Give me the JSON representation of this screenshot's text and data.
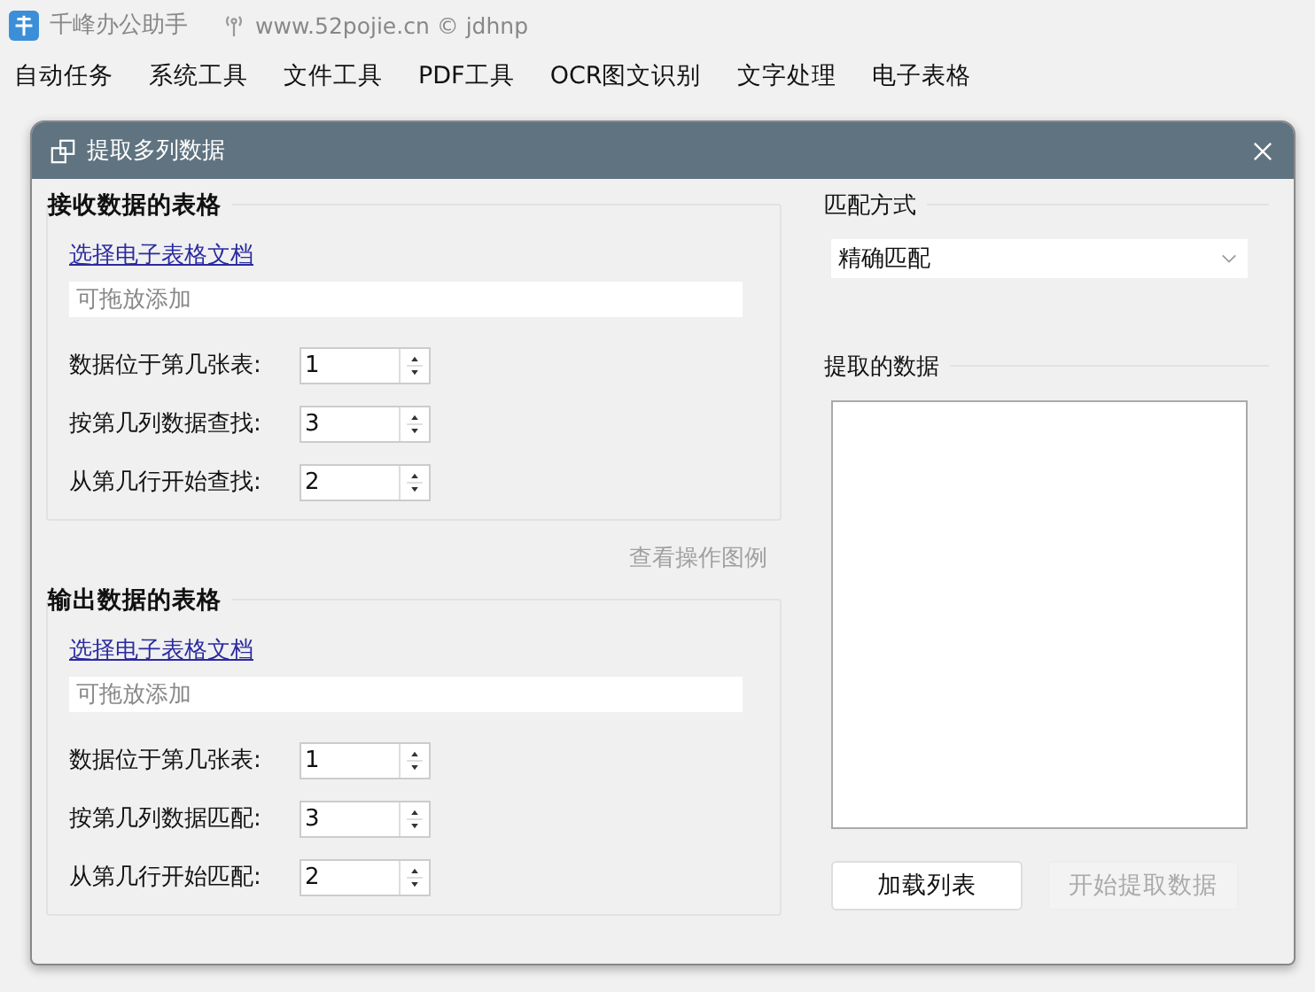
{
  "app": {
    "title": "千峰办公助手",
    "credit": "www.52pojie.cn © jdhnp"
  },
  "menu": [
    "自动任务",
    "系统工具",
    "文件工具",
    "PDF工具",
    "OCR图文识别",
    "文字处理",
    "电子表格"
  ],
  "dialog": {
    "title": "提取多列数据",
    "sections": [
      {
        "title": "接收数据的表格",
        "link": "选择电子表格文档",
        "drop_field": {
          "placeholder": "可拖放添加"
        },
        "spinners": [
          {
            "label": "数据位于第几张表:",
            "value": "1"
          },
          {
            "label": "按第几列数据查找:",
            "value": "3"
          },
          {
            "label": "从第几行开始查找:",
            "value": "2"
          }
        ]
      },
      {
        "title": "输出数据的表格",
        "link": "选择电子表格文档",
        "drop_field": {
          "placeholder": "可拖放添加"
        },
        "spinners": [
          {
            "label": "数据位于第几张表:",
            "value": "1"
          },
          {
            "label": "按第几列数据匹配:",
            "value": "3"
          },
          {
            "label": "从第几行开始匹配:",
            "value": "2"
          }
        ]
      }
    ],
    "example_link": {
      "label": "查看操作图例",
      "disabled": true
    },
    "match_mode": {
      "title": "匹配方式",
      "value": "精确匹配"
    },
    "extracted": {
      "title": "提取的数据"
    },
    "buttons": [
      {
        "label": "加载列表",
        "disabled": false
      },
      {
        "label": "开始提取数据",
        "disabled": true
      }
    ]
  }
}
